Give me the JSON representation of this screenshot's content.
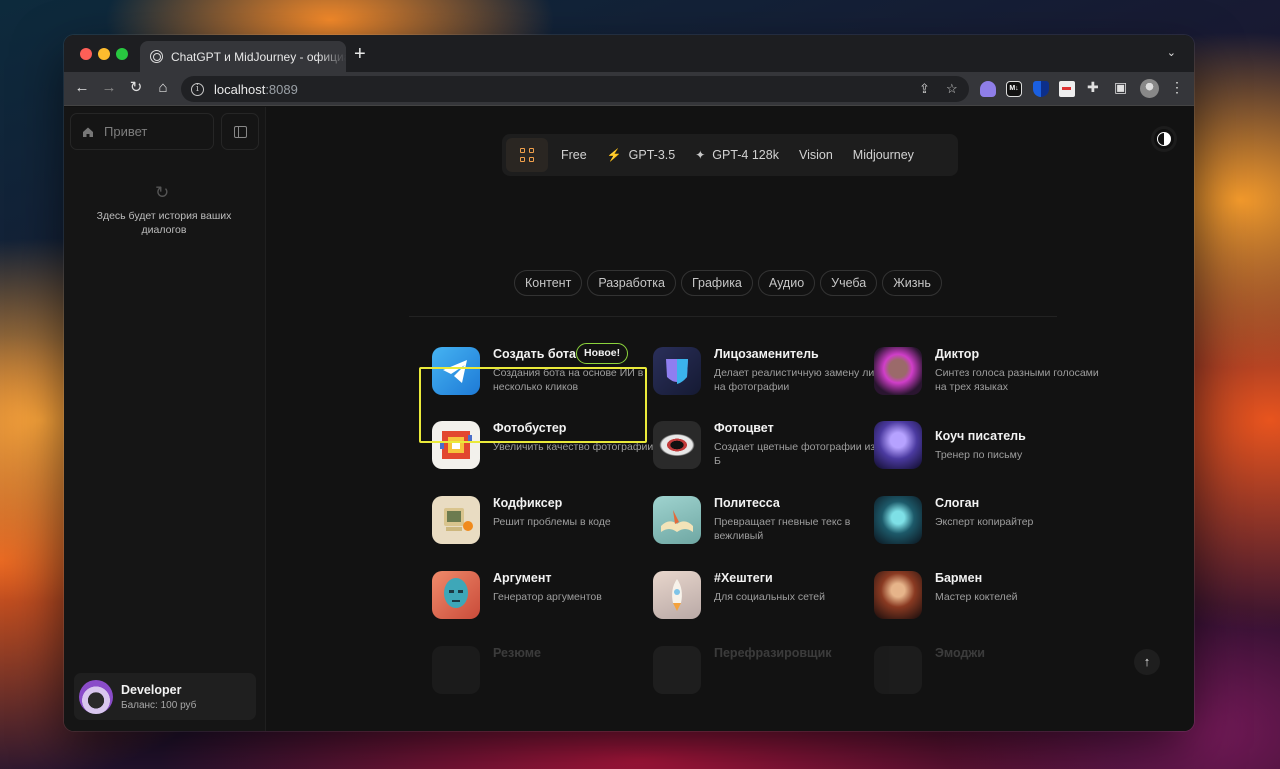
{
  "browser": {
    "tab_title": "ChatGPT и MidJourney - официальный",
    "new_tab": "+",
    "tab_list": "⌄",
    "url_host": "localhost",
    "url_port": ":8089"
  },
  "sidebar": {
    "home_label": "Привет",
    "history_empty": "Здесь будет история ваших диалогов",
    "user": {
      "name": "Developer",
      "balance": "Баланс: 100 руб"
    }
  },
  "models": [
    {
      "label": "Free",
      "icon": ""
    },
    {
      "label": "GPT-3.5",
      "icon": "lightning-icon"
    },
    {
      "label": "GPT-4 128k",
      "icon": "sparkle-icon"
    },
    {
      "label": "Vision",
      "icon": ""
    },
    {
      "label": "Midjourney",
      "icon": ""
    }
  ],
  "categories": [
    "Контент",
    "Разработка",
    "Графика",
    "Аудио",
    "Учеба",
    "Жизнь"
  ],
  "bots": [
    {
      "title": "Создать бота",
      "desc": "Создания бота на основе ИИ в несколько кликов",
      "badge": "Новое!",
      "icon": "telegram-icon"
    },
    {
      "title": "Лицозаменитель",
      "desc": "Делает реалистичную замену лица на фотографии",
      "icon": "mask-icon"
    },
    {
      "title": "Диктор",
      "desc": "Синтез голоса разными голосами на трех языках",
      "icon": "neon-face-icon"
    },
    {
      "title": "Фотобустер",
      "desc": "Увеличить качество фотографии",
      "icon": "pixel-icon"
    },
    {
      "title": "Фотоцвет",
      "desc": "Создает цветные фотографии из Ч/Б",
      "icon": "eye-icon"
    },
    {
      "title": "Коуч писатель",
      "desc": "Тренер по письму",
      "icon": "book-icon"
    },
    {
      "title": "Кодфиксер",
      "desc": "Решит проблемы в коде",
      "icon": "retro-computer-icon"
    },
    {
      "title": "Политесса",
      "desc": "Превращает гневные текс в вежливый",
      "icon": "open-book-icon"
    },
    {
      "title": "Слоган",
      "desc": "Эксперт копирайтер",
      "icon": "magic-book-icon"
    },
    {
      "title": "Аргумент",
      "desc": "Генератор аргументов",
      "icon": "statue-head-icon"
    },
    {
      "title": "#Хештеги",
      "desc": "Для социальных сетей",
      "icon": "rocket-icon"
    },
    {
      "title": "Бармен",
      "desc": "Мастер коктелей",
      "icon": "bartender-icon"
    },
    {
      "title": "Резюме",
      "desc": "",
      "icon": "resume-icon"
    },
    {
      "title": "Перефразировщик",
      "desc": "",
      "icon": "paraphrase-icon"
    },
    {
      "title": "Эмоджи",
      "desc": "",
      "icon": "emoji-icon"
    }
  ],
  "colors": {
    "accent": "#f0a04b",
    "highlight": "#eaea3a",
    "badge_border": "#8bd33c"
  }
}
